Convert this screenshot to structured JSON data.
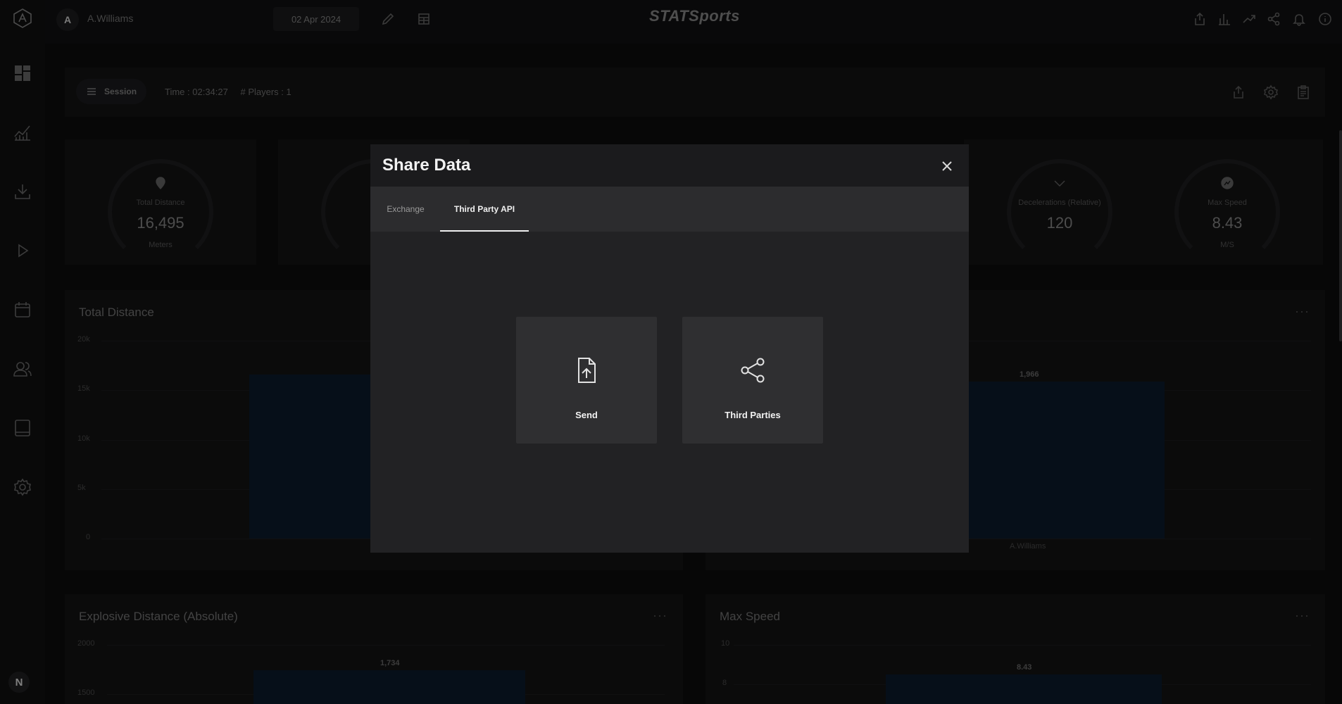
{
  "sidebar": {
    "user_initial": "N",
    "icons": [
      "logo-icon",
      "dashboard-icon",
      "analytics-icon",
      "download-icon",
      "play-icon",
      "calendar-icon",
      "team-icon",
      "tablet-icon",
      "settings-icon"
    ]
  },
  "topbar": {
    "avatar_initial": "A",
    "user_name": "A.Williams",
    "date": "02 Apr 2024",
    "brand": "STATSports"
  },
  "session": {
    "label": "Session",
    "time": "Time : 02:34:27",
    "players": "# Players : 1"
  },
  "kpis": [
    {
      "label": "Total Distance",
      "value": "16,495",
      "unit": "Meters"
    },
    {
      "label": "Decelerations (Relative)",
      "value": "120",
      "unit": ""
    },
    {
      "label": "Max Speed",
      "value": "8.43",
      "unit": "M/S"
    }
  ],
  "panels": {
    "total_distance": {
      "title": "Total Distance",
      "ticks": [
        "20k",
        "15k",
        "10k",
        "5k",
        "0"
      ]
    },
    "right_top": {
      "bar_label": "1,966",
      "x_label": "A.Williams"
    },
    "explosive": {
      "title": "Explosive Distance (Absolute)",
      "ticks": [
        "2000",
        "1500"
      ],
      "bar_label": "1,734"
    },
    "max_speed": {
      "title": "Max Speed",
      "ticks": [
        "10",
        "8"
      ],
      "bar_label": "8.43"
    },
    "menu": "···"
  },
  "modal": {
    "title": "Share Data",
    "tabs": [
      {
        "label": "Exchange",
        "active": false
      },
      {
        "label": "Third Party API",
        "active": true
      }
    ],
    "tiles": [
      {
        "label": "Send",
        "icon": "file-upload-icon"
      },
      {
        "label": "Third Parties",
        "icon": "share-icon"
      }
    ]
  }
}
